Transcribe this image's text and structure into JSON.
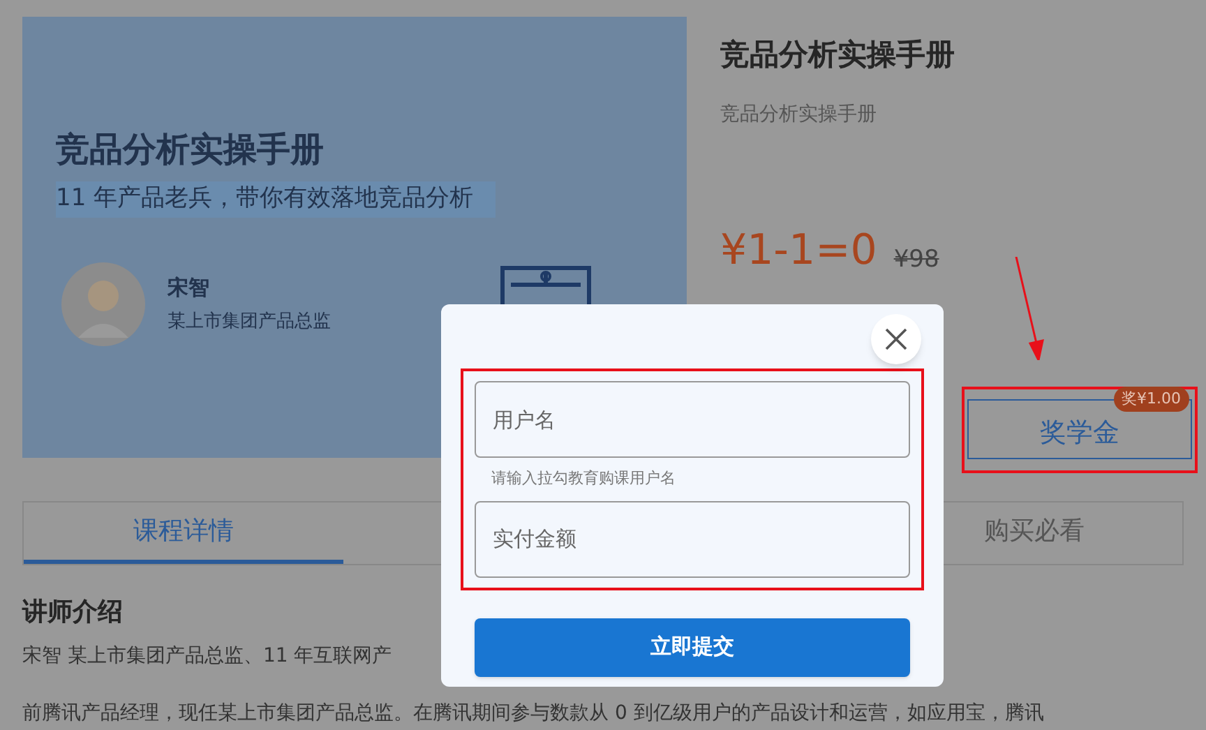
{
  "banner": {
    "title": "竞品分析实操手册",
    "subtitle": "11 年产品老兵，带你有效落地竞品分析",
    "teacher_name": "宋智",
    "teacher_title": "某上市集团产品总监"
  },
  "course": {
    "title": "竞品分析实操手册",
    "subtitle": "竞品分析实操手册",
    "price": "¥1-1=0",
    "original_price": "¥98",
    "scholarship_button": "奖学金",
    "scholarship_badge": "奖¥1.00"
  },
  "tabs": [
    {
      "label": "课程详情",
      "selected": true
    },
    {
      "label": "购买必看",
      "selected": false
    }
  ],
  "section_heading": "讲师介绍",
  "paragraphs": [
    "宋智 某上市集团产品总监、11 年互联网产",
    "前腾讯产品经理，现任某上市集团产品总监。在腾讯期间参与数款从 0 到亿级用户的产品设计和运营，如应用宝，腾讯"
  ],
  "dialog": {
    "fields": [
      {
        "placeholder": "用户名",
        "hint": "请输入拉勾教育购课用户名"
      },
      {
        "placeholder": "实付金额"
      }
    ],
    "submit": "立即提交"
  }
}
